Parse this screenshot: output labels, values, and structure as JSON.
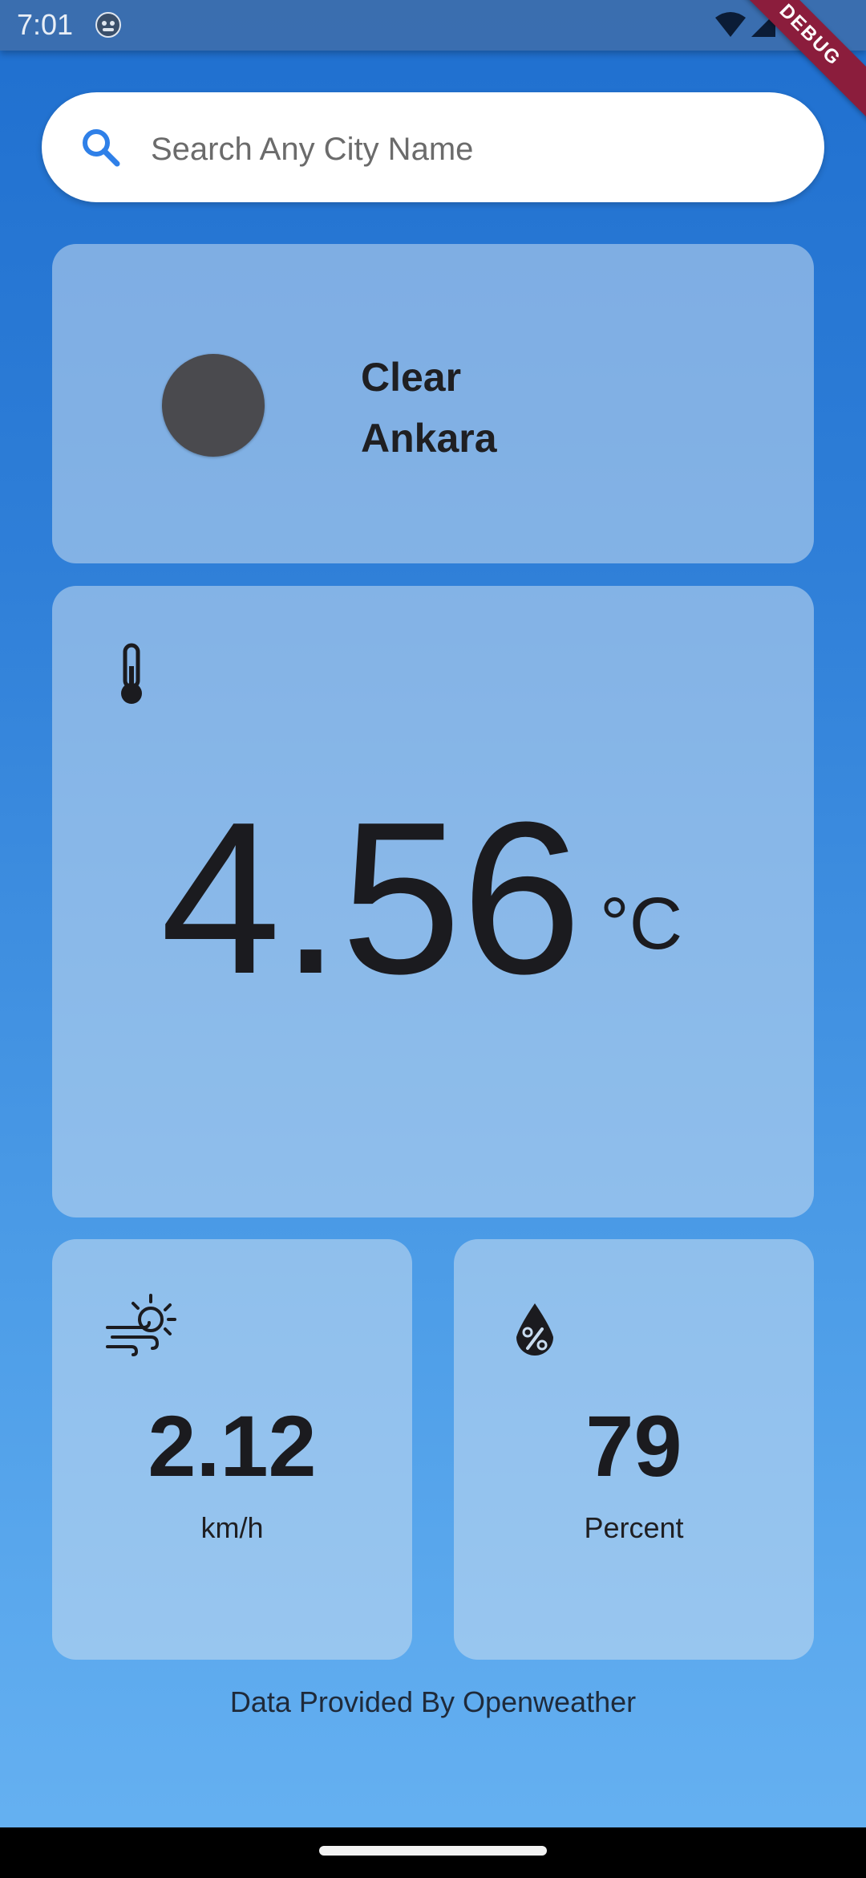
{
  "status_bar": {
    "time": "7:01",
    "icons": [
      "notification-icon",
      "wifi-icon",
      "cellular-signal-icon"
    ]
  },
  "debug_banner": {
    "label": "DEBUG",
    "color": "#8b1d3c"
  },
  "search": {
    "placeholder": "Search Any City Name",
    "value": "",
    "icon": "search-icon",
    "icon_color": "#2f80e8"
  },
  "condition_card": {
    "condition": "Clear",
    "city": "Ankara",
    "icon": "weather-icon"
  },
  "temperature_card": {
    "icon": "thermometer-icon",
    "value": "4.56",
    "unit": "°C"
  },
  "wind_card": {
    "icon": "wind-icon",
    "value": "2.12",
    "unit": "km/h"
  },
  "humidity_card": {
    "icon": "humidity-icon",
    "value": "79",
    "unit": "Percent"
  },
  "footer": {
    "credit": "Data Provided By Openweather"
  },
  "colors": {
    "background_top": "#1f6fcf",
    "background_bottom": "#67b2f2",
    "card": "rgba(200,220,240,0.55)",
    "text": "#1b1b1f"
  }
}
